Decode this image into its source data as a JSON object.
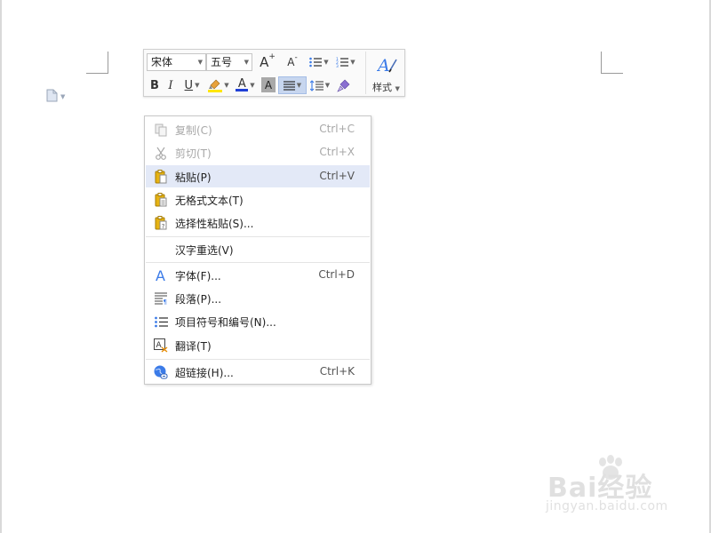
{
  "toolbar": {
    "font_name": "宋体",
    "font_size": "五号",
    "grow_font_label": "A",
    "shrink_font_label": "A",
    "bold_label": "B",
    "italic_label": "I",
    "underline_label": "U",
    "font_color_label": "A",
    "char_shading_label": "A",
    "styles_label": "样式"
  },
  "context_menu": {
    "items": [
      {
        "label": "复制(C)",
        "shortcut": "Ctrl+C"
      },
      {
        "label": "剪切(T)",
        "shortcut": "Ctrl+X"
      },
      {
        "label": "粘贴(P)",
        "shortcut": "Ctrl+V"
      },
      {
        "label": "无格式文本(T)",
        "shortcut": ""
      },
      {
        "label": "选择性粘贴(S)...",
        "shortcut": ""
      },
      {
        "label": "汉字重选(V)",
        "shortcut": ""
      },
      {
        "label": "字体(F)...",
        "shortcut": "Ctrl+D"
      },
      {
        "label": "段落(P)...",
        "shortcut": ""
      },
      {
        "label": "项目符号和编号(N)...",
        "shortcut": ""
      },
      {
        "label": "翻译(T)",
        "shortcut": ""
      },
      {
        "label": "超链接(H)...",
        "shortcut": "Ctrl+K"
      }
    ]
  },
  "watermark": {
    "brand": "Bai经验",
    "url": "jingyan.baidu.com"
  },
  "colors": {
    "accent": "#3b7be8",
    "highlight": "#e3e9f7",
    "paste_icon": "#e6b312",
    "disabled": "#a8a8a8"
  }
}
